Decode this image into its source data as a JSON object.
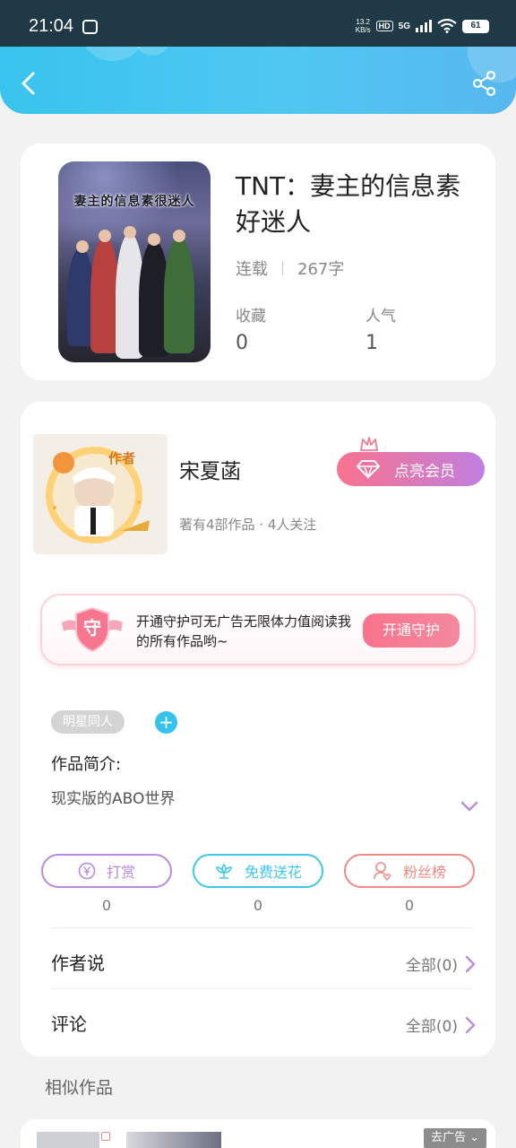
{
  "status_bar": {
    "time": "21:04",
    "net_speed_value": "13.2",
    "net_speed_unit": "KB/s",
    "hd": "HD",
    "network": "5G",
    "battery": "61"
  },
  "book": {
    "cover_text": "妻主的信息素很迷人",
    "title": "TNT：妻主的信息素好迷人",
    "status": "连载",
    "word_count": "267字",
    "favorites_label": "收藏",
    "favorites_value": "0",
    "popularity_label": "人气",
    "popularity_value": "1"
  },
  "author": {
    "badge": "作者",
    "name": "宋夏菡",
    "stats": "著有4部作品 · 4人关注",
    "vip_button": "点亮会员"
  },
  "guard": {
    "shield_char": "守",
    "text": "开通守护可无广告无限体力值阅读我的所有作品哟~",
    "button": "开通守护"
  },
  "tags": [
    "明星同人"
  ],
  "intro": {
    "label": "作品简介:",
    "text": "现实版的ABO世界"
  },
  "actions": [
    {
      "label": "打赏",
      "count": "0",
      "color": "#b98be0"
    },
    {
      "label": "免费送花",
      "count": "0",
      "color": "#3fc6ec"
    },
    {
      "label": "粉丝榜",
      "count": "0",
      "color": "#f08a85"
    }
  ],
  "rows": {
    "author_says": {
      "label": "作者说",
      "value": "全部(0)"
    },
    "comments": {
      "label": "评论",
      "value": "全部(0)"
    }
  },
  "similar_title": "相似作品",
  "ad_button": "去广告"
}
